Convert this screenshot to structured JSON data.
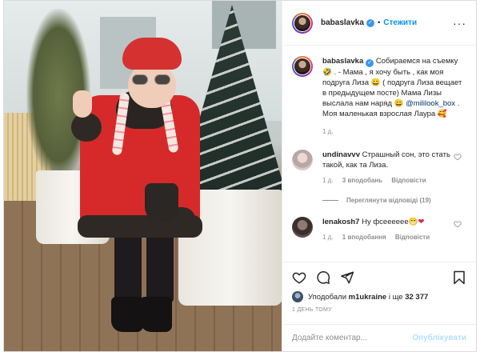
{
  "post": {
    "author": "babaslavka",
    "follow_label": "Стежити",
    "separator": "•",
    "more_glyph": "···"
  },
  "caption": {
    "author": "babaslavka",
    "text_1": "Собираемся на съемку",
    "text_2": " . - Мама , я хочу быть , как моя подруга Лиза",
    "text_3": " ( подруга Лиза вещает в предыдущем посте) Мама Лизы выслала нам наряд",
    "mention": "@mililook_box",
    "text_4": " . Моя маленькая взрослая Лаура",
    "time": "1 д."
  },
  "comments": [
    {
      "author": "undinavvv",
      "text": "Страшный сон, это стать такой, как та Лиза.",
      "time": "1 д.",
      "likes": "3 вподобань",
      "reply": "Відповісти",
      "view_replies": "Переглянути відповіді (19)"
    },
    {
      "author": "lenakosh7",
      "text": "Ну фсееееее",
      "time": "1 д.",
      "likes": "1 вподобання",
      "reply": "Відповісти"
    }
  ],
  "likes": {
    "prefix": "Уподобали",
    "user": "m1ukraine",
    "middle": " і ще ",
    "count": "32 377"
  },
  "post_time": "1 ДЕНЬ ТОМУ",
  "add_comment": {
    "placeholder": "Додайте коментар...",
    "publish": "Опублікувати"
  },
  "colors": {
    "accent": "#0095f6",
    "verified": "#3897f0",
    "muted": "#8e8e8e",
    "publish_disabled": "#b2dffc"
  },
  "icons": [
    "verified-badge-icon",
    "heart-icon",
    "comment-icon",
    "share-icon",
    "bookmark-icon",
    "more-icon"
  ]
}
